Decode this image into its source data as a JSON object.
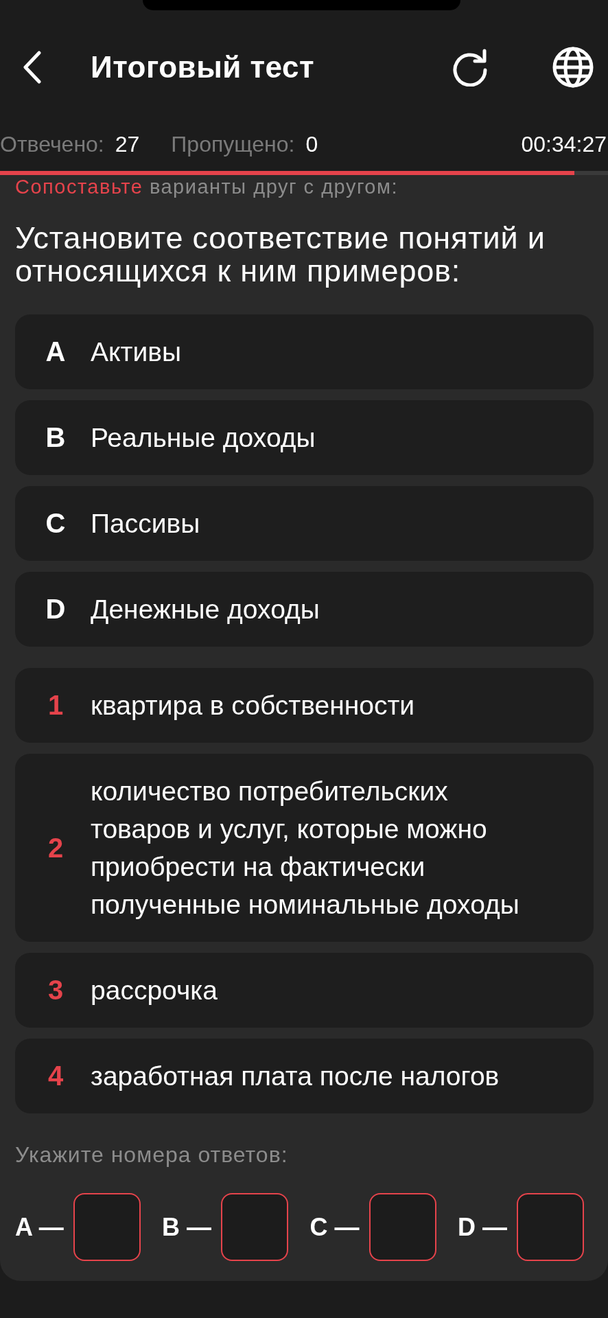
{
  "header": {
    "title": "Итоговый тест"
  },
  "stats": [
    {
      "label": "Отвечено:",
      "value": "27"
    },
    {
      "label": "Пропущено:",
      "value": "0"
    }
  ],
  "timer": "00:34:27",
  "progress": {
    "level": 0.945
  },
  "instruction": {
    "highlight": "Сопоставьте",
    "text": "варианты друг с другом:"
  },
  "question": "Установите соответствие понятий и относящихся к ним примеров:",
  "concepts": [
    {
      "key": "A",
      "text": "Активы"
    },
    {
      "key": "B",
      "text": "Реальные доходы"
    },
    {
      "key": "C",
      "text": "Пассивы"
    },
    {
      "key": "D",
      "text": "Денежные доходы"
    }
  ],
  "examples": [
    {
      "key": "1",
      "text": "квартира в собственности"
    },
    {
      "key": "2",
      "text": "количество потребительских товаров и услуг, которые можно приобрести на фактически полученные номинальные доходы"
    },
    {
      "key": "3",
      "text": "рассрочка"
    },
    {
      "key": "4",
      "text": "заработная плата после налогов"
    }
  ],
  "answer_prompt": "Укажите номера ответов:",
  "answers": [
    {
      "label": "A —"
    },
    {
      "label": "B —"
    },
    {
      "label": "C —"
    },
    {
      "label": "D —"
    }
  ]
}
